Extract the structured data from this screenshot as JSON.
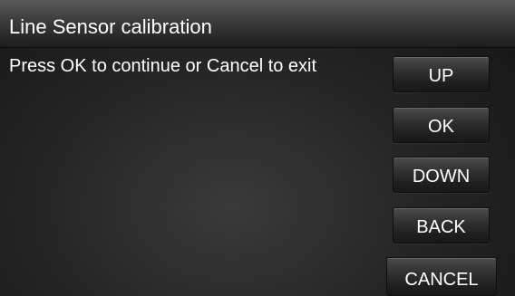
{
  "window": {
    "title": "Line Sensor calibration"
  },
  "main": {
    "message": "Press OK to continue or Cancel to exit"
  },
  "buttons": {
    "up": "UP",
    "ok": "OK",
    "down": "DOWN",
    "back": "BACK",
    "cancel": "CANCEL"
  }
}
